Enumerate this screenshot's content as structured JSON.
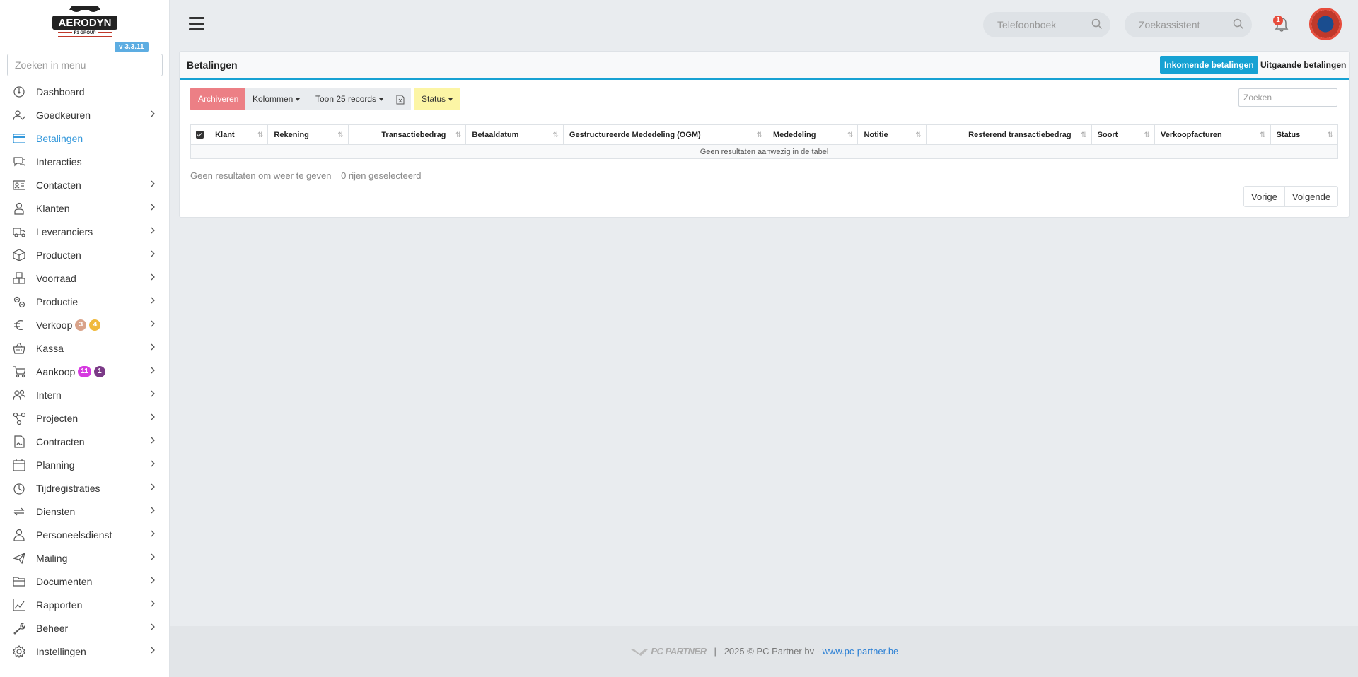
{
  "app": {
    "logo_text": "AERODYN",
    "logo_subtext": "F1 GROUP",
    "version": "v 3.3.11"
  },
  "sidebar": {
    "search_placeholder": "Zoeken in menu",
    "items": [
      {
        "label": "Dashboard",
        "icon": "dashboard-icon",
        "arrow": false
      },
      {
        "label": "Goedkeuren",
        "icon": "approve-user-icon",
        "arrow": true
      },
      {
        "label": "Betalingen",
        "icon": "credit-card-icon",
        "arrow": false,
        "active": true
      },
      {
        "label": "Interacties",
        "icon": "chat-icon",
        "arrow": false
      },
      {
        "label": "Contacten",
        "icon": "contact-card-icon",
        "arrow": true
      },
      {
        "label": "Klanten",
        "icon": "customer-icon",
        "arrow": true
      },
      {
        "label": "Leveranciers",
        "icon": "truck-icon",
        "arrow": true
      },
      {
        "label": "Producten",
        "icon": "box-icon",
        "arrow": true
      },
      {
        "label": "Voorraad",
        "icon": "boxes-icon",
        "arrow": true
      },
      {
        "label": "Productie",
        "icon": "gears-icon",
        "arrow": true
      },
      {
        "label": "Verkoop",
        "icon": "euro-icon",
        "arrow": true,
        "badges": [
          {
            "text": "3",
            "color": "#d9a38a"
          },
          {
            "text": "4",
            "color": "#f0b93c"
          }
        ]
      },
      {
        "label": "Kassa",
        "icon": "basket-icon",
        "arrow": true
      },
      {
        "label": "Aankoop",
        "icon": "cart-icon",
        "arrow": true,
        "badges": [
          {
            "text": "11",
            "color": "#d63ae0"
          },
          {
            "text": "1",
            "color": "#7b3a87"
          }
        ]
      },
      {
        "label": "Intern",
        "icon": "users-icon",
        "arrow": true
      },
      {
        "label": "Projecten",
        "icon": "network-icon",
        "arrow": true
      },
      {
        "label": "Contracten",
        "icon": "contract-icon",
        "arrow": true
      },
      {
        "label": "Planning",
        "icon": "calendar-icon",
        "arrow": true
      },
      {
        "label": "Tijdregistraties",
        "icon": "timer-icon",
        "arrow": true
      },
      {
        "label": "Diensten",
        "icon": "repeat-icon",
        "arrow": true
      },
      {
        "label": "Personeelsdienst",
        "icon": "person-icon",
        "arrow": true
      },
      {
        "label": "Mailing",
        "icon": "send-icon",
        "arrow": true
      },
      {
        "label": "Documenten",
        "icon": "folder-icon",
        "arrow": true
      },
      {
        "label": "Rapporten",
        "icon": "chart-line-icon",
        "arrow": true
      },
      {
        "label": "Beheer",
        "icon": "wrench-icon",
        "arrow": true
      },
      {
        "label": "Instellingen",
        "icon": "gear-icon",
        "arrow": true
      }
    ]
  },
  "topbar": {
    "phonebook_placeholder": "Telefoonboek",
    "assistant_placeholder": "Zoekassistent",
    "notification_count": "1"
  },
  "page": {
    "title": "Betalingen",
    "incoming_label": "Inkomende betalingen",
    "outgoing_label": "Uitgaande betalingen"
  },
  "toolbar": {
    "archive_label": "Archiveren",
    "columns_label": "Kolommen",
    "show_records_label": "Toon 25 records",
    "status_label": "Status",
    "search_placeholder": "Zoeken"
  },
  "table": {
    "columns": [
      {
        "label": "Klant"
      },
      {
        "label": "Rekening"
      },
      {
        "label": "Transactiebedrag",
        "align": "right"
      },
      {
        "label": "Betaaldatum"
      },
      {
        "label": "Gestructureerde Mededeling (OGM)"
      },
      {
        "label": "Mededeling"
      },
      {
        "label": "Notitie"
      },
      {
        "label": "Resterend transactiebedrag",
        "align": "right"
      },
      {
        "label": "Soort"
      },
      {
        "label": "Verkoopfacturen"
      },
      {
        "label": "Status"
      }
    ],
    "empty_message": "Geen resultaten aanwezig in de tabel",
    "info_text": "Geen resultaten om weer te geven",
    "selected_text": "0 rijen geselecteerd",
    "prev_label": "Vorige",
    "next_label": "Volgende"
  },
  "footer": {
    "brand": "PC PARTNER",
    "separator": "|",
    "copyright": "2025 © PC Partner bv - ",
    "link_text": "www.pc-partner.be"
  },
  "colors": {
    "accent": "#17a2d3",
    "active_menu": "#3498db",
    "archive": "#ec7f85",
    "status_btn": "#fcf5a5",
    "notification": "#e74c3c"
  }
}
